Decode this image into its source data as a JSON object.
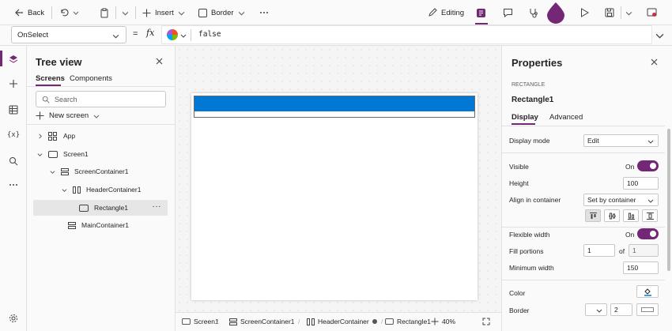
{
  "toolbar": {
    "back_label": "Back",
    "insert_label": "Insert",
    "border_label": "Border",
    "editing_label": "Editing"
  },
  "formula_bar": {
    "property": "OnSelect",
    "fx": "fx",
    "value": "false"
  },
  "tree_view": {
    "title": "Tree view",
    "tabs": [
      "Screens",
      "Components"
    ],
    "search_placeholder": "Search",
    "new_screen_label": "New screen",
    "items": [
      {
        "label": "App"
      },
      {
        "label": "Screen1"
      },
      {
        "label": "ScreenContainer1"
      },
      {
        "label": "HeaderContainer1"
      },
      {
        "label": "Rectangle1",
        "more": "···"
      },
      {
        "label": "MainContainer1"
      }
    ]
  },
  "status_bar": {
    "crumbs": [
      "Screen1",
      "ScreenContainer1",
      "HeaderContainer",
      "Rectangle1"
    ],
    "zoom": "40%"
  },
  "properties": {
    "title": "Properties",
    "type": "RECTANGLE",
    "name": "Rectangle1",
    "tabs": [
      "Display",
      "Advanced"
    ],
    "display_mode_label": "Display mode",
    "display_mode_value": "Edit",
    "visible_label": "Visible",
    "visible_value": "On",
    "height_label": "Height",
    "height_value": "100",
    "align_label": "Align in container",
    "align_value": "Set by container",
    "flex_label": "Flexible width",
    "flex_value": "On",
    "fill_label": "Fill portions",
    "fill_value": "1",
    "fill_of": "of",
    "fill_total": "1",
    "minwidth_label": "Minimum width",
    "minwidth_value": "150",
    "color_label": "Color",
    "border_label": "Border",
    "border_value": "2"
  },
  "colors": {
    "accent": "#742774",
    "header_blue": "#0078d4"
  }
}
